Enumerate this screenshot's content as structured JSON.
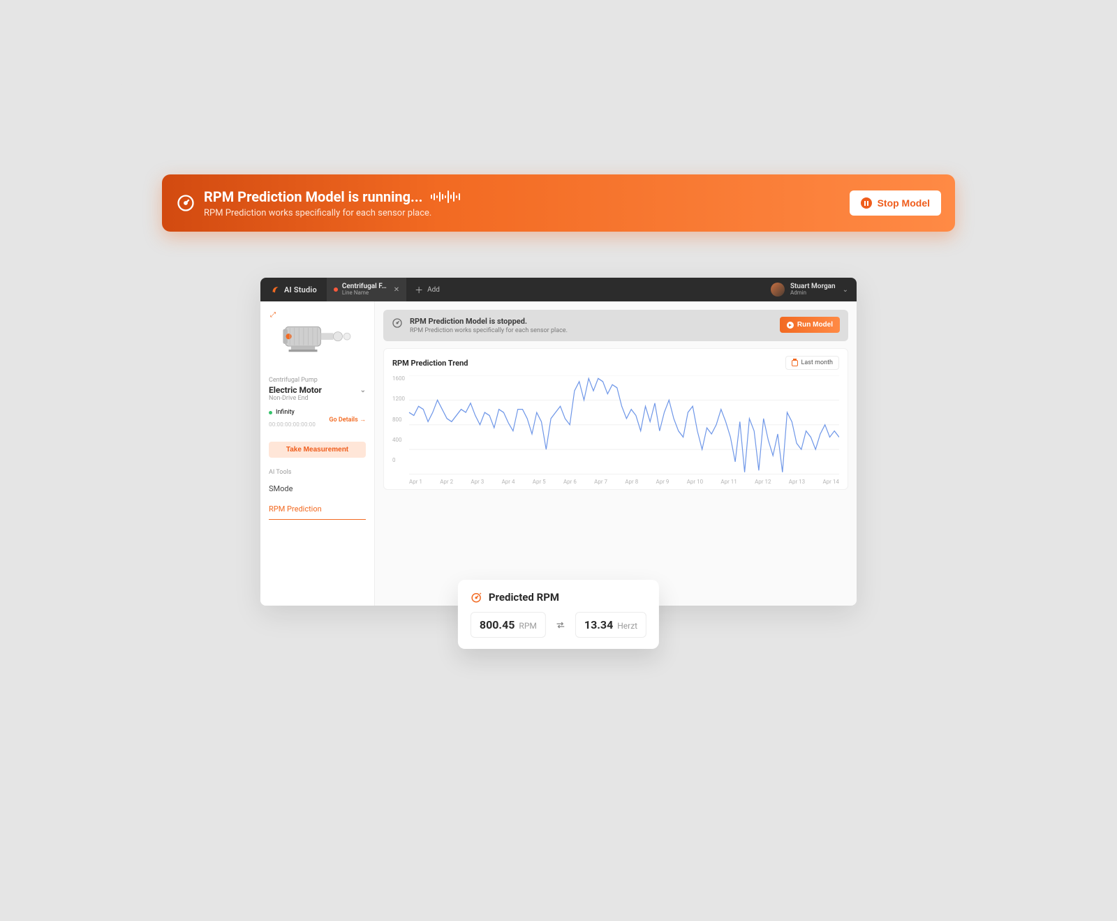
{
  "banner": {
    "title": "RPM Prediction Model is running...",
    "sub": "RPM Prediction works specifically for each sensor place.",
    "stop_label": "Stop Model",
    "wave_heights": [
      6,
      10,
      4,
      14,
      8,
      4,
      18,
      6,
      14,
      4,
      10
    ]
  },
  "titlebar": {
    "brand": "AI Studio",
    "tab": {
      "title": "Centrifugal F…",
      "sub": "Line Name"
    },
    "add_label": "Add",
    "user": {
      "name": "Stuart Morgan",
      "role": "Admin"
    }
  },
  "sidebar": {
    "asset_type": "Centrifugal Pump",
    "asset_name": "Electric Motor",
    "asset_sub": "Non-Drive End",
    "status_label": "Infinity",
    "timecode": "00:00:00:00:00:00",
    "details_label": "Go Details →",
    "measure_label": "Take Measurement",
    "section_label": "AI Tools",
    "nav": [
      "SMode",
      "RPM Prediction"
    ]
  },
  "status": {
    "title": "RPM Prediction Model is stopped.",
    "sub": "RPM Prediction works specifically for each sensor place.",
    "run_label": "Run Model"
  },
  "chart": {
    "title": "RPM Prediction Trend",
    "range_label": "Last month"
  },
  "chart_data": {
    "type": "line",
    "title": "RPM Prediction Trend",
    "xlabel": "",
    "ylabel": "",
    "ylim": [
      0,
      1600
    ],
    "y_ticks": [
      1600,
      1200,
      800,
      400,
      0
    ],
    "categories": [
      "Apr 1",
      "Apr 2",
      "Apr 3",
      "Apr 4",
      "Apr 5",
      "Apr 6",
      "Apr 7",
      "Apr 8",
      "Apr 9",
      "Apr 10",
      "Apr 11",
      "Apr 12",
      "Apr 13",
      "Apr 14"
    ],
    "values": [
      1000,
      950,
      1100,
      1050,
      850,
      1000,
      1200,
      1050,
      900,
      850,
      950,
      1050,
      1000,
      1150,
      950,
      800,
      1000,
      950,
      750,
      1050,
      1000,
      830,
      700,
      1050,
      1050,
      900,
      650,
      1000,
      850,
      400,
      900,
      1000,
      1100,
      900,
      800,
      1350,
      1500,
      1200,
      1550,
      1350,
      1550,
      1500,
      1300,
      1450,
      1400,
      1100,
      900,
      1050,
      950,
      700,
      1100,
      850,
      1150,
      700,
      1000,
      1200,
      900,
      700,
      600,
      1000,
      1100,
      700,
      400,
      750,
      650,
      800,
      1050,
      850,
      600,
      200,
      850,
      30,
      900,
      700,
      60,
      900,
      550,
      300,
      650,
      30,
      1000,
      850,
      500,
      400,
      700,
      600,
      400,
      650,
      800,
      600,
      700,
      600
    ]
  },
  "predicted": {
    "heading": "Predicted RPM",
    "left_value": "800.45",
    "left_unit": "RPM",
    "right_value": "13.34",
    "right_unit": "Herzt"
  }
}
